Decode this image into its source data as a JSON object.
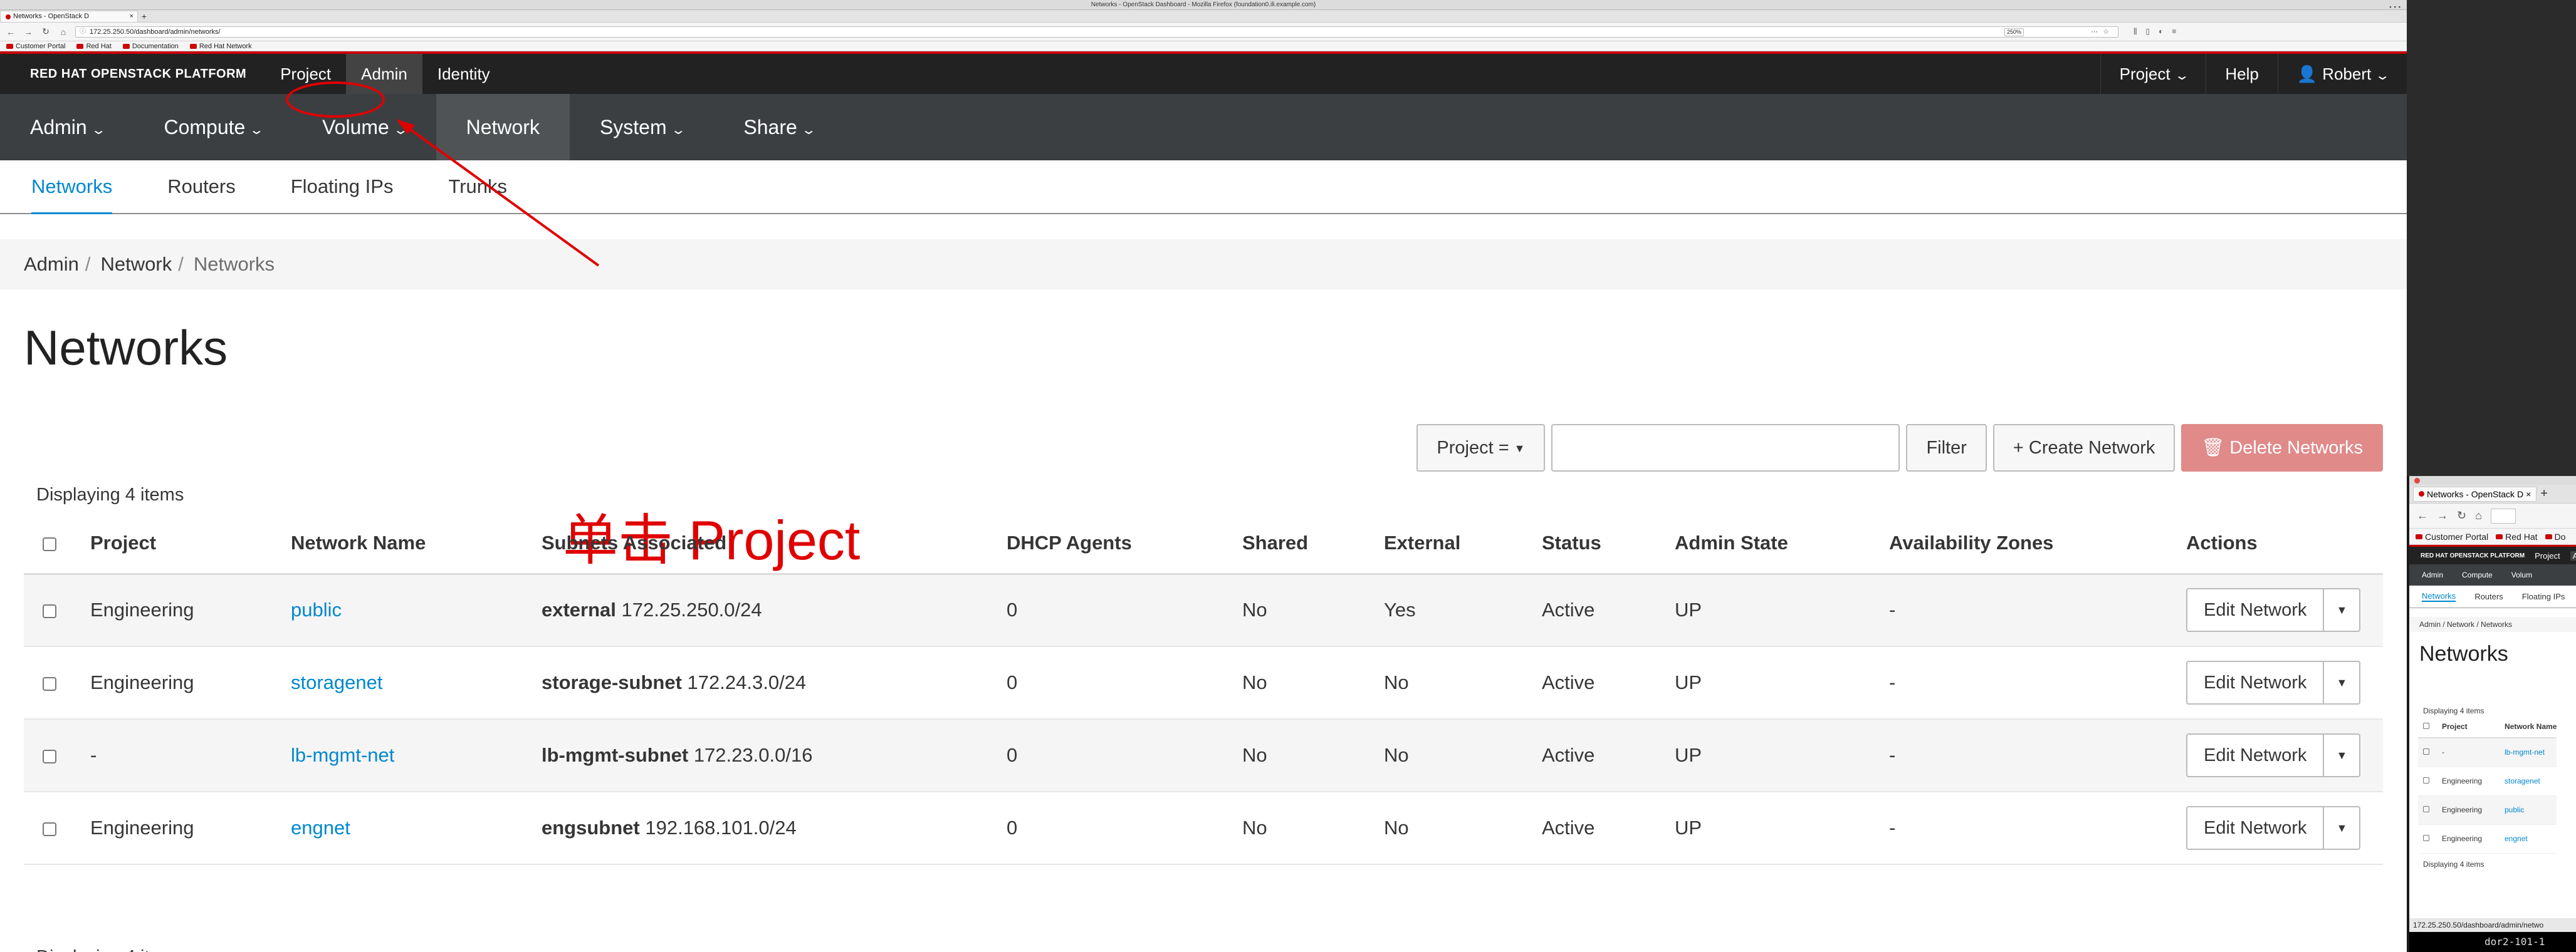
{
  "browser": {
    "window_title": "Networks - OpenStack Dashboard - Mozilla Firefox (foundation0.ili.example.com)",
    "tab_label": "Networks - OpenStack D",
    "url": "172.25.250.50/dashboard/admin/networks/",
    "zoom": "250%",
    "bookmarks": [
      "Customer Portal",
      "Red Hat",
      "Documentation",
      "Red Hat Network"
    ]
  },
  "masthead": {
    "brand": "RED HAT OPENSTACK PLATFORM",
    "nav": [
      "Project",
      "Admin",
      "Identity"
    ],
    "right": {
      "project": "Project",
      "help": "Help",
      "user": "Robert"
    }
  },
  "secondary_nav": [
    "Admin",
    "Compute",
    "Volume",
    "Network",
    "System",
    "Share"
  ],
  "tertiary_nav": [
    "Networks",
    "Routers",
    "Floating IPs",
    "Trunks"
  ],
  "breadcrumb": [
    "Admin",
    "Network",
    "Networks"
  ],
  "page_title": "Networks",
  "annotation": {
    "text": "单击 Project",
    "color": "#e00000"
  },
  "toolbar": {
    "filter_select": "Project =",
    "filter_button": "Filter",
    "create_button": "Create Network",
    "delete_button": "Delete Networks"
  },
  "displaying": "Displaying 4 items",
  "table": {
    "headers": [
      "Project",
      "Network Name",
      "Subnets Associated",
      "DHCP Agents",
      "Shared",
      "External",
      "Status",
      "Admin State",
      "Availability Zones",
      "Actions"
    ],
    "rows": [
      {
        "project": "Engineering",
        "name": "public",
        "subnet_name": "external",
        "subnet_cidr": "172.25.250.0/24",
        "dhcp": "0",
        "shared": "No",
        "external": "Yes",
        "status": "Active",
        "admin_state": "UP",
        "az": "-",
        "action": "Edit Network"
      },
      {
        "project": "Engineering",
        "name": "storagenet",
        "subnet_name": "storage-subnet",
        "subnet_cidr": "172.24.3.0/24",
        "dhcp": "0",
        "shared": "No",
        "external": "No",
        "status": "Active",
        "admin_state": "UP",
        "az": "-",
        "action": "Edit Network"
      },
      {
        "project": "-",
        "name": "lb-mgmt-net",
        "subnet_name": "lb-mgmt-subnet",
        "subnet_cidr": "172.23.0.0/16",
        "dhcp": "0",
        "shared": "No",
        "external": "No",
        "status": "Active",
        "admin_state": "UP",
        "az": "-",
        "action": "Edit Network"
      },
      {
        "project": "Engineering",
        "name": "engnet",
        "subnet_name": "engsubnet",
        "subnet_cidr": "192.168.101.0/24",
        "dhcp": "0",
        "shared": "No",
        "external": "No",
        "status": "Active",
        "admin_state": "UP",
        "az": "-",
        "action": "Edit Network"
      }
    ]
  },
  "colors": {
    "brand_red": "#cc0000",
    "link": "#0088ce",
    "masthead": "#222222",
    "secondary_nav": "#3c3f42"
  },
  "mini_window": {
    "tab_label": "Networks - OpenStack D",
    "bookmarks": [
      "Customer Portal",
      "Red Hat",
      "Do"
    ],
    "brand": "RED HAT OPENSTACK PLATFORM",
    "nav": [
      "Project",
      "Ad"
    ],
    "secondary_nav": [
      "Admin",
      "Compute",
      "Volum"
    ],
    "tertiary_nav": [
      "Networks",
      "Routers",
      "Floating IPs"
    ],
    "breadcrumb": "Admin / Network / Networks",
    "page_title": "Networks",
    "displaying_top": "Displaying 4 items",
    "headers": [
      "Project",
      "Network Name"
    ],
    "rows": [
      {
        "project": "-",
        "name": "lb-mgmt-net"
      },
      {
        "project": "Engineering",
        "name": "storagenet"
      },
      {
        "project": "Engineering",
        "name": "public"
      },
      {
        "project": "Engineering",
        "name": "engnet"
      }
    ],
    "displaying_bottom": "Displaying 4 items",
    "status_url": "172.25.250.50/dashboard/admin/netwo",
    "terminal": "dor2-101-1"
  }
}
